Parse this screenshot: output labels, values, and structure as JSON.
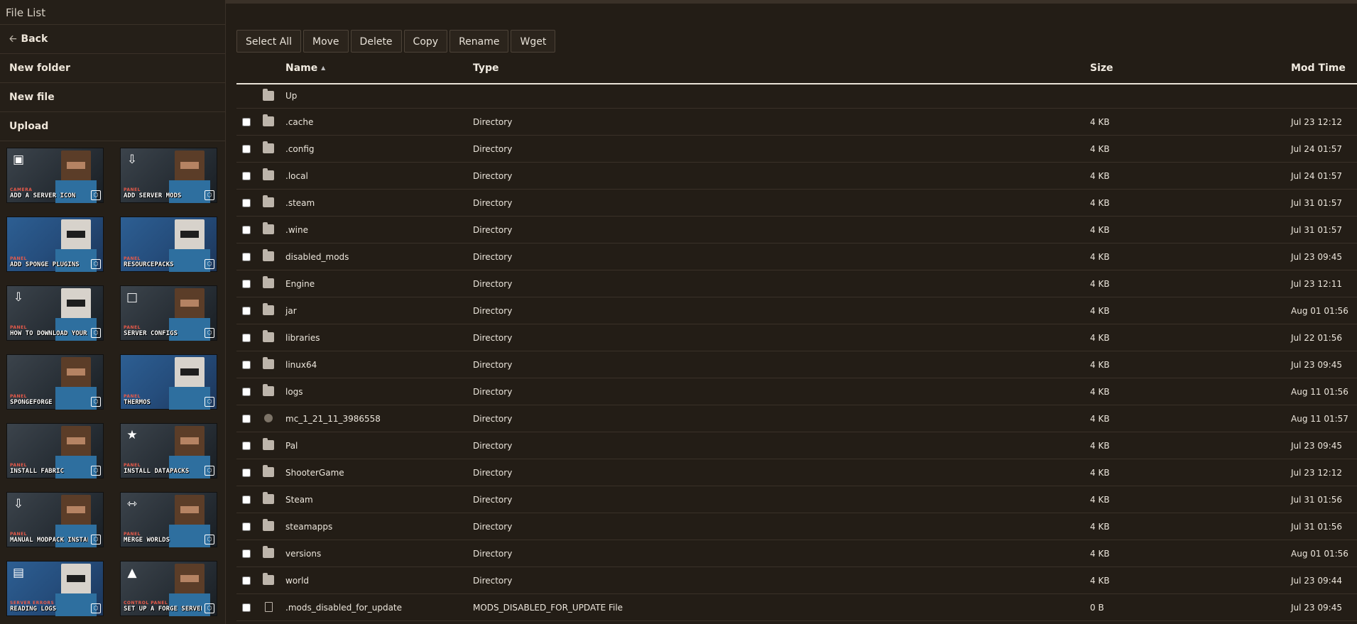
{
  "sidebar": {
    "title": "File List",
    "back_label": "Back",
    "new_folder_label": "New folder",
    "new_file_label": "New file",
    "upload_label": "Upload",
    "guides": [
      {
        "tag": "CAMERA",
        "caption": "ADD A SERVER ICON",
        "style": "dark",
        "icon": "image-icon",
        "fig": "brown"
      },
      {
        "tag": "PANEL",
        "caption": "ADD SERVER MODS",
        "style": "dark",
        "icon": "download-icon",
        "fig": "brown"
      },
      {
        "tag": "PANEL",
        "caption": "ADD SPONGE PLUGINS",
        "style": "blue",
        "icon": "",
        "fig": "white"
      },
      {
        "tag": "PANEL",
        "caption": "RESOURCEPACKS",
        "style": "blue",
        "icon": "",
        "fig": "white"
      },
      {
        "tag": "PANEL",
        "caption": "HOW TO DOWNLOAD YOUR WORLD",
        "style": "dark",
        "icon": "download-icon",
        "fig": "white"
      },
      {
        "tag": "PANEL",
        "caption": "SERVER CONFIGS",
        "style": "dark",
        "icon": "file-icon",
        "fig": "brown"
      },
      {
        "tag": "PANEL",
        "caption": "SPONGEFORGE",
        "style": "dark",
        "icon": "",
        "fig": "brown"
      },
      {
        "tag": "PANEL",
        "caption": "THERMOS",
        "style": "blue",
        "icon": "",
        "fig": "white"
      },
      {
        "tag": "PANEL",
        "caption": "INSTALL FABRIC",
        "style": "dark",
        "icon": "",
        "fig": "brown"
      },
      {
        "tag": "PANEL",
        "caption": "INSTALL DATAPACKS",
        "style": "dark",
        "icon": "star-file-icon",
        "fig": "brown"
      },
      {
        "tag": "PANEL",
        "caption": "MANUAL MODPACK INSTALL",
        "style": "dark",
        "icon": "download-icon",
        "fig": "brown"
      },
      {
        "tag": "PANEL",
        "caption": "MERGE WORLDS",
        "style": "dark",
        "icon": "merge-icon",
        "fig": "brown"
      },
      {
        "tag": "SERVER ERRORS",
        "caption": "READING LOGS",
        "style": "blue",
        "icon": "book-icon",
        "fig": "white"
      },
      {
        "tag": "CONTROL PANEL",
        "caption": "SET UP A FORGE SERVER",
        "style": "dark",
        "icon": "anvil-icon",
        "fig": "brown"
      }
    ]
  },
  "toolbar": {
    "select_all": "Select All",
    "move": "Move",
    "delete": "Delete",
    "copy": "Copy",
    "rename": "Rename",
    "wget": "Wget"
  },
  "table": {
    "headers": {
      "name": "Name",
      "sort_indicator": "▲",
      "type": "Type",
      "size": "Size",
      "mod_time": "Mod Time"
    },
    "up_label": "Up",
    "rows": [
      {
        "name": ".cache",
        "type": "Directory",
        "size": "4 KB",
        "mod": "Jul 23 12:12",
        "icon": "folder-icon"
      },
      {
        "name": ".config",
        "type": "Directory",
        "size": "4 KB",
        "mod": "Jul 24 01:57",
        "icon": "folder-icon"
      },
      {
        "name": ".local",
        "type": "Directory",
        "size": "4 KB",
        "mod": "Jul 24 01:57",
        "icon": "folder-icon"
      },
      {
        "name": ".steam",
        "type": "Directory",
        "size": "4 KB",
        "mod": "Jul 31 01:57",
        "icon": "folder-icon"
      },
      {
        "name": ".wine",
        "type": "Directory",
        "size": "4 KB",
        "mod": "Jul 31 01:57",
        "icon": "folder-icon"
      },
      {
        "name": "disabled_mods",
        "type": "Directory",
        "size": "4 KB",
        "mod": "Jul 23 09:45",
        "icon": "folder-icon"
      },
      {
        "name": "Engine",
        "type": "Directory",
        "size": "4 KB",
        "mod": "Jul 23 12:11",
        "icon": "folder-icon"
      },
      {
        "name": "jar",
        "type": "Directory",
        "size": "4 KB",
        "mod": "Aug 01 01:56",
        "icon": "folder-icon"
      },
      {
        "name": "libraries",
        "type": "Directory",
        "size": "4 KB",
        "mod": "Jul 22 01:56",
        "icon": "folder-icon"
      },
      {
        "name": "linux64",
        "type": "Directory",
        "size": "4 KB",
        "mod": "Jul 23 09:45",
        "icon": "folder-icon"
      },
      {
        "name": "logs",
        "type": "Directory",
        "size": "4 KB",
        "mod": "Aug 11 01:56",
        "icon": "folder-icon"
      },
      {
        "name": "mc_1_21_11_3986558",
        "type": "Directory",
        "size": "4 KB",
        "mod": "Aug 11 01:57",
        "icon": "globe-icon"
      },
      {
        "name": "Pal",
        "type": "Directory",
        "size": "4 KB",
        "mod": "Jul 23 09:45",
        "icon": "folder-icon"
      },
      {
        "name": "ShooterGame",
        "type": "Directory",
        "size": "4 KB",
        "mod": "Jul 23 12:12",
        "icon": "folder-icon"
      },
      {
        "name": "Steam",
        "type": "Directory",
        "size": "4 KB",
        "mod": "Jul 31 01:56",
        "icon": "folder-icon"
      },
      {
        "name": "steamapps",
        "type": "Directory",
        "size": "4 KB",
        "mod": "Jul 31 01:56",
        "icon": "folder-icon"
      },
      {
        "name": "versions",
        "type": "Directory",
        "size": "4 KB",
        "mod": "Aug 01 01:56",
        "icon": "folder-icon"
      },
      {
        "name": "world",
        "type": "Directory",
        "size": "4 KB",
        "mod": "Jul 23 09:44",
        "icon": "folder-icon"
      },
      {
        "name": ".mods_disabled_for_update",
        "type": "MODS_DISABLED_FOR_UPDATE File",
        "size": "0 B",
        "mod": "Jul 23 09:45",
        "icon": "file-icon"
      }
    ]
  }
}
